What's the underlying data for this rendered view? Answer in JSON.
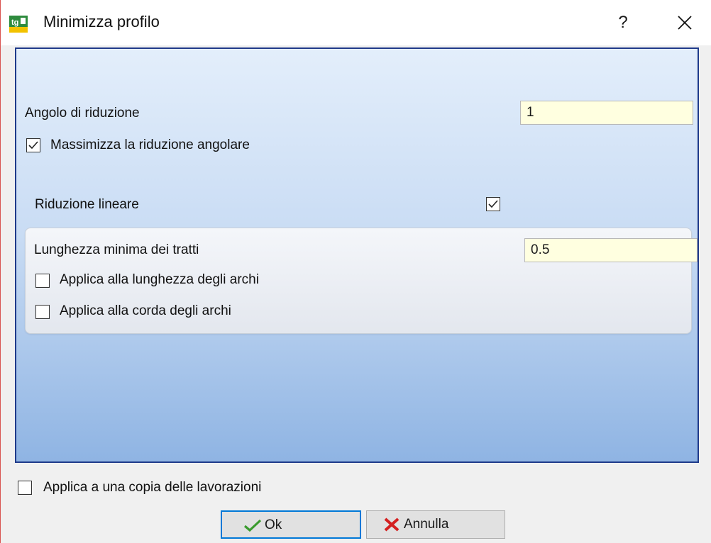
{
  "window": {
    "title": "Minimizza profilo",
    "help_label": "?"
  },
  "form": {
    "angle_label": "Angolo di riduzione",
    "angle_value": "1",
    "maximize_label": "Massimizza la riduzione angolare",
    "maximize_checked": true,
    "linear_label": "Riduzione lineare",
    "linear_checked": true,
    "group": {
      "min_length_label": "Lunghezza minima dei tratti",
      "min_length_value": "0.5",
      "arc_length_label": "Applica alla lunghezza degli archi",
      "arc_length_checked": false,
      "arc_chord_label": "Applica alla corda degli archi",
      "arc_chord_checked": false
    }
  },
  "footer": {
    "copy_label": "Applica a una copia delle lavorazioni",
    "copy_checked": false,
    "ok_label": "Ok",
    "cancel_label": "Annulla"
  },
  "colors": {
    "panel_border": "#1f3a8a",
    "input_bg": "#ffffe0",
    "default_button_border": "#0078d7",
    "ok_icon": "#3a9b2e",
    "cancel_icon": "#d42020"
  },
  "icons": {
    "app": "app-logo-icon",
    "help": "help-icon",
    "close": "close-icon",
    "ok": "checkmark-icon",
    "cancel": "x-icon"
  }
}
